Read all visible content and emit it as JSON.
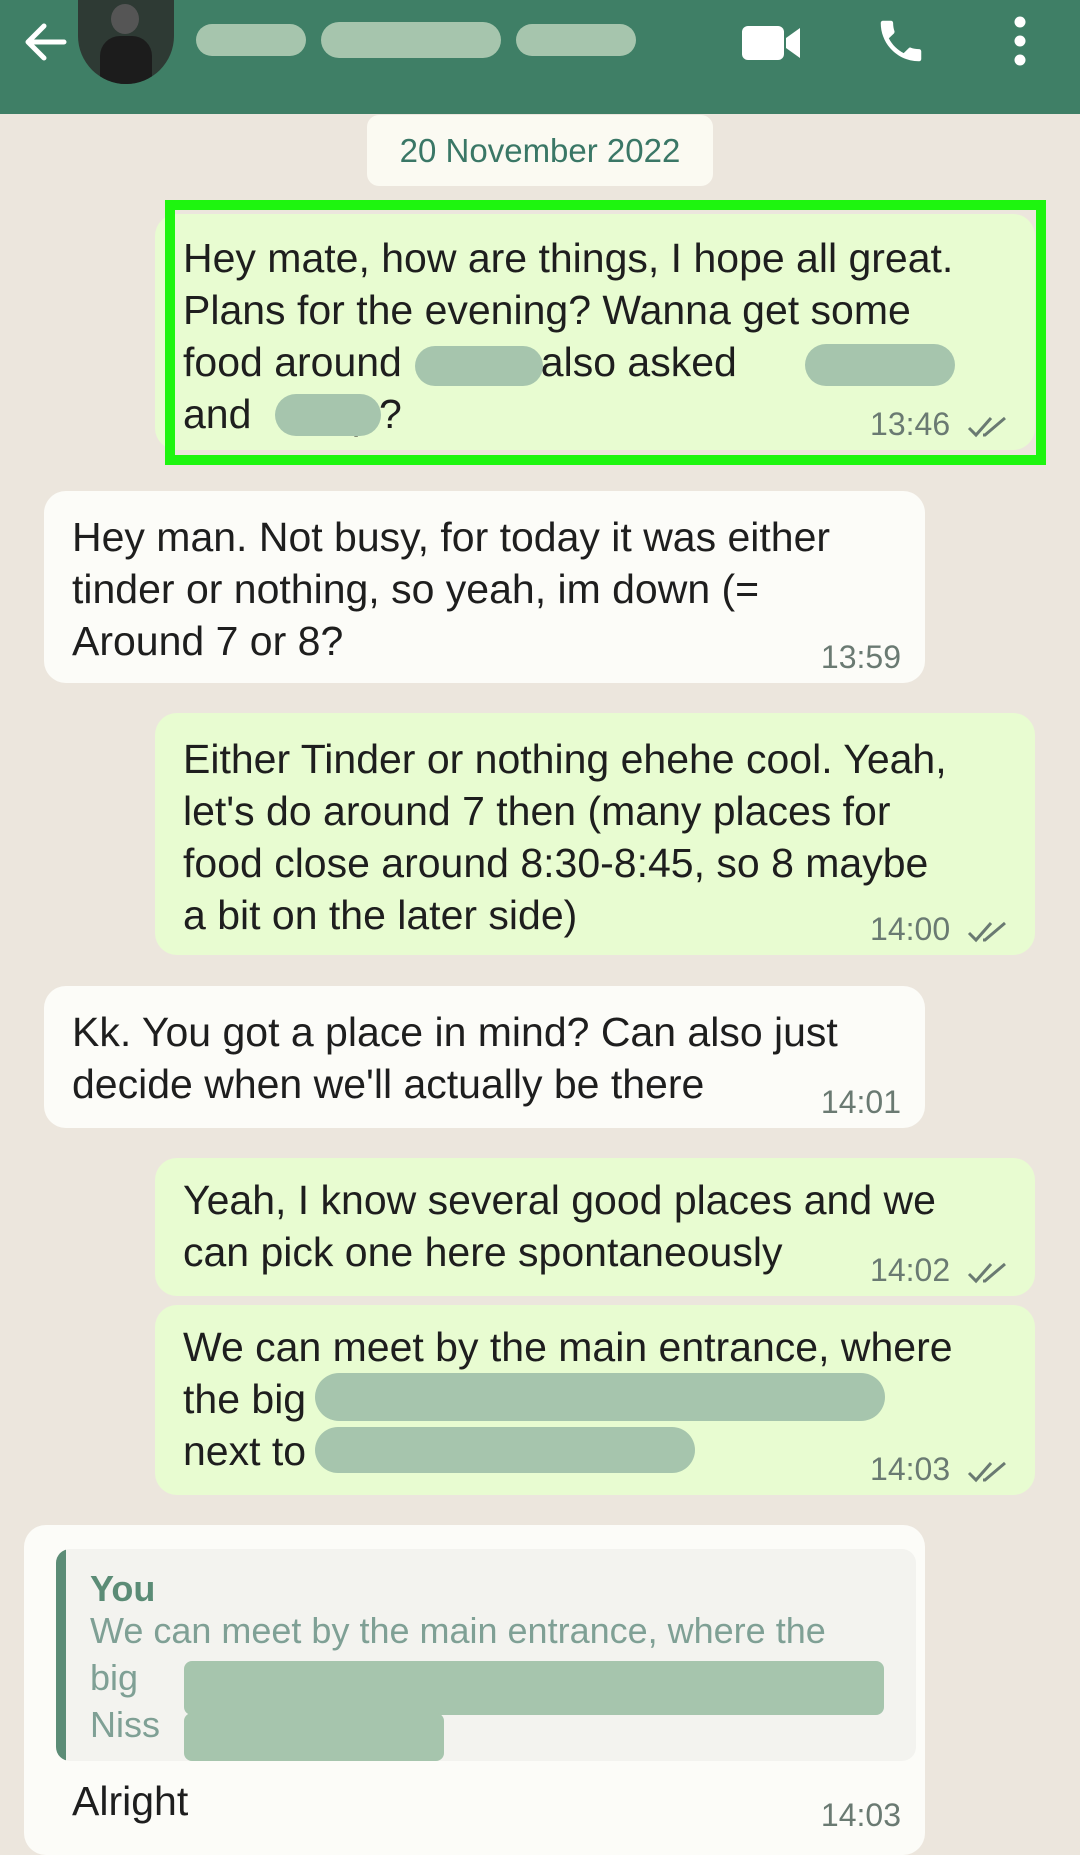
{
  "header": {
    "contact_name": "",
    "icons": [
      "back-arrow-icon",
      "video-call-icon",
      "phone-icon",
      "more-vertical-icon"
    ],
    "color": "#3f7f66"
  },
  "date_chip": "20 November 2022",
  "messages": [
    {
      "direction": "outgoing",
      "text": "Hey mate, how are things, I hope all great.\nPlans for the evening? Wanna get some\nfood around         (I also asked\nand         ) ?",
      "time": "13:46",
      "read": true,
      "highlighted": true
    },
    {
      "direction": "incoming",
      "text": "Hey man. Not busy, for today it was either\ntinder or nothing, so yeah, im down (=\nAround 7 or 8?",
      "time": "13:59"
    },
    {
      "direction": "outgoing",
      "text": "Either Tinder or nothing ehehe cool. Yeah,\nlet's do around 7 then (many places for\nfood close around 8:30-8:45, so 8 maybe\na bit on the later side)",
      "time": "14:00",
      "read": true
    },
    {
      "direction": "incoming",
      "text": "Kk. You got a place in mind? Can also just\ndecide when we'll actually be there",
      "time": "14:01"
    },
    {
      "direction": "outgoing",
      "text": "Yeah, I know several good places and we\ncan pick one here spontaneously",
      "time": "14:02",
      "read": true
    },
    {
      "direction": "outgoing",
      "text": "We can meet by the main entrance, where\nthe big                                   and\nnext to",
      "time": "14:03",
      "read": true
    },
    {
      "direction": "incoming",
      "quote_author": "You",
      "quote_text": "We can meet by the main entrance, where the\nbig\nNiss",
      "text": "Alright",
      "time": "14:03"
    }
  ],
  "colors": {
    "outgoing_bubble": "#e8fcd1",
    "incoming_bubble": "#fcfcf8",
    "background": "#ece6dd",
    "highlight_border": "#1ef50f",
    "read_ticks": "#6a7a72"
  }
}
